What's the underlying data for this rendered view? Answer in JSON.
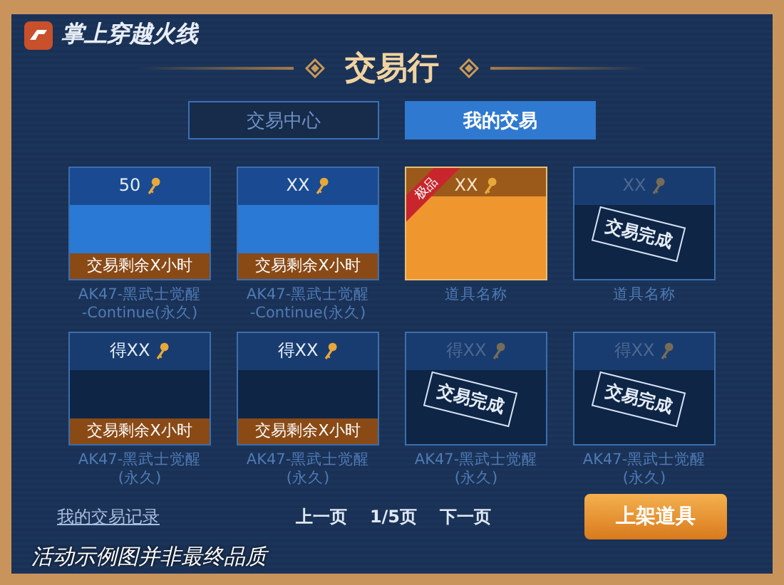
{
  "app": {
    "name": "掌上穿越火线"
  },
  "title": "交易行",
  "tabs": [
    {
      "label": "交易中心",
      "selected": false
    },
    {
      "label": "我的交易",
      "selected": true
    }
  ],
  "items": [
    {
      "price": "50",
      "kind": "listed",
      "status_text": "交易剩余X小时",
      "name": "AK47-黑武士觉醒\n-Continue(永久)",
      "selected": false
    },
    {
      "price": "XX",
      "kind": "listed",
      "status_text": "交易剩余X小时",
      "name": "AK47-黑武士觉醒\n-Continue(永久)",
      "selected": false
    },
    {
      "price": "XX",
      "kind": "plain",
      "badge": "极品",
      "name": "道具名称",
      "selected": true
    },
    {
      "price": "XX",
      "kind": "done",
      "status_text": "交易完成",
      "name": "道具名称",
      "selected": false
    },
    {
      "price": "得XX",
      "kind": "pending",
      "status_text": "交易剩余X小时",
      "name": "AK47-黑武士觉醒\n(永久)",
      "selected": false
    },
    {
      "price": "得XX",
      "kind": "pending",
      "status_text": "交易剩余X小时",
      "name": "AK47-黑武士觉醒\n(永久)",
      "selected": false
    },
    {
      "price": "得XX",
      "kind": "done",
      "status_text": "交易完成",
      "name": "AK47-黑武士觉醒\n(永久)",
      "selected": false
    },
    {
      "price": "得XX",
      "kind": "done",
      "status_text": "交易完成",
      "name": "AK47-黑武士觉醒\n(永久)",
      "selected": false
    }
  ],
  "footer": {
    "history_link": "我的交易记录",
    "prev": "上一页",
    "page": "1/5页",
    "next": "下一页",
    "list_button": "上架道具"
  },
  "caption": "活动示例图并非最终品质"
}
